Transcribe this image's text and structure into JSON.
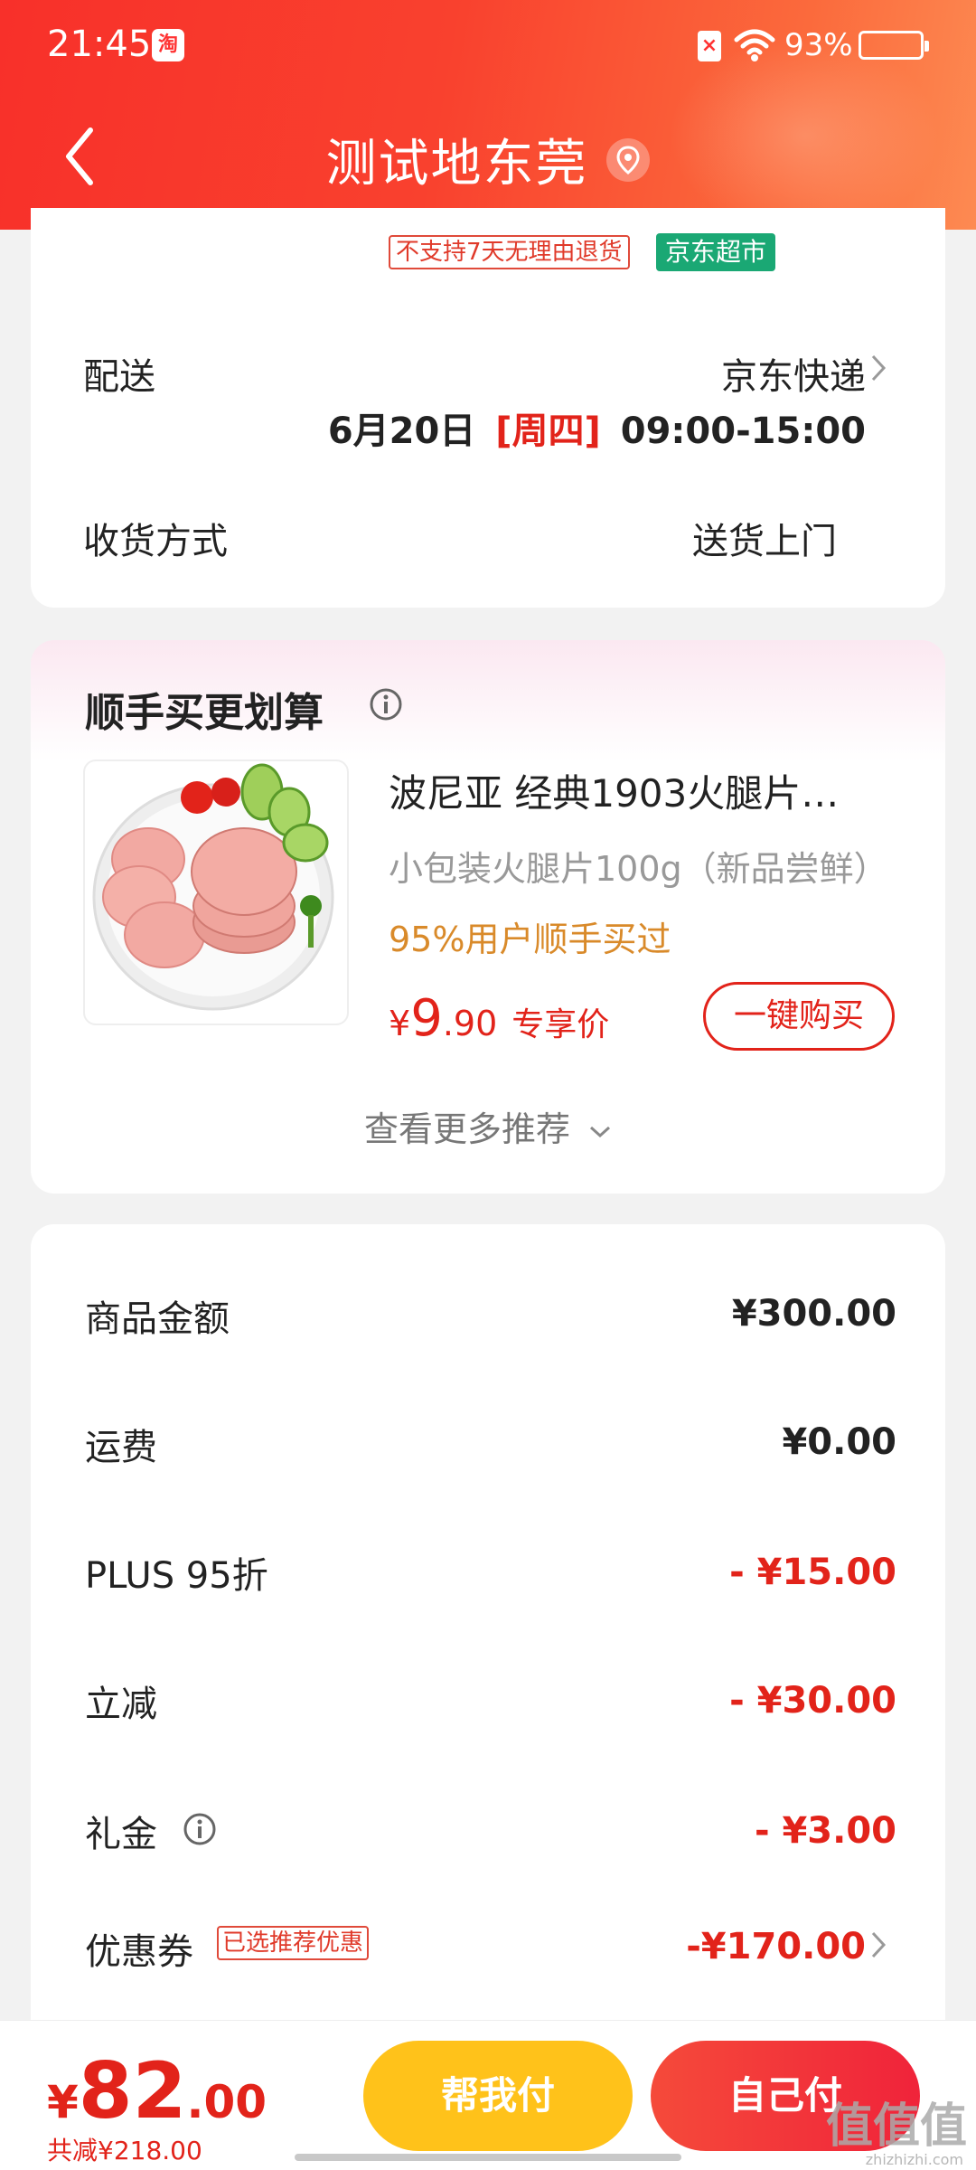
{
  "status_bar": {
    "time": "21:45",
    "app_badge": "淘",
    "sim_icon": "sim-missing-icon",
    "battery_text": "93%",
    "battery_level": 0.93
  },
  "header": {
    "title": "测试地东莞",
    "back_icon": "chevron-left-icon",
    "location_icon": "location-pin-icon"
  },
  "delivery": {
    "badge_noreturn": "不支持7天无理由退货",
    "badge_market": "京东超市",
    "label": "配送",
    "carrier": "京东快递",
    "date": "6月20日",
    "weekday": "[周四]",
    "time_window": "09:00-15:00",
    "method_label": "收货方式",
    "method_value": "送货上门"
  },
  "recommend": {
    "title": "顺手买更划算",
    "product_name": "波尼亚 经典1903火腿片…",
    "product_sub": "小包装火腿片100g（新品尝鲜）",
    "product_stat": "95%用户顺手买过",
    "price_currency": "¥",
    "price_int": "9",
    "price_dec": ".90",
    "price_tag": "专享价",
    "buy_button": "一键购买",
    "more": "查看更多推荐"
  },
  "price_summary": {
    "rows": [
      {
        "label": "商品金额",
        "value": "¥300.00"
      },
      {
        "label": "运费",
        "value": "¥0.00"
      },
      {
        "label": "PLUS 95折",
        "value": "- ¥15.00"
      },
      {
        "label": "立减",
        "value": "- ¥30.00"
      },
      {
        "label": "礼金",
        "value": "- ¥3.00"
      },
      {
        "label": "优惠券",
        "value": "-¥170.00"
      }
    ],
    "coupon_tag": "已选推荐优惠"
  },
  "bottom_bar": {
    "currency": "¥",
    "total_int": "82",
    "total_dec": ".00",
    "saved": "共减¥218.00",
    "help_pay": "帮我付",
    "self_pay": "自己付",
    "watermark": "值值值",
    "watermark_sub": "zhizhizhi.com"
  },
  "colors": {
    "accent": "#e2231a",
    "header": "#f9412e",
    "market_green": "#1aa874",
    "help_yellow": "#ffc21a",
    "stat_orange": "#d98a2a"
  }
}
